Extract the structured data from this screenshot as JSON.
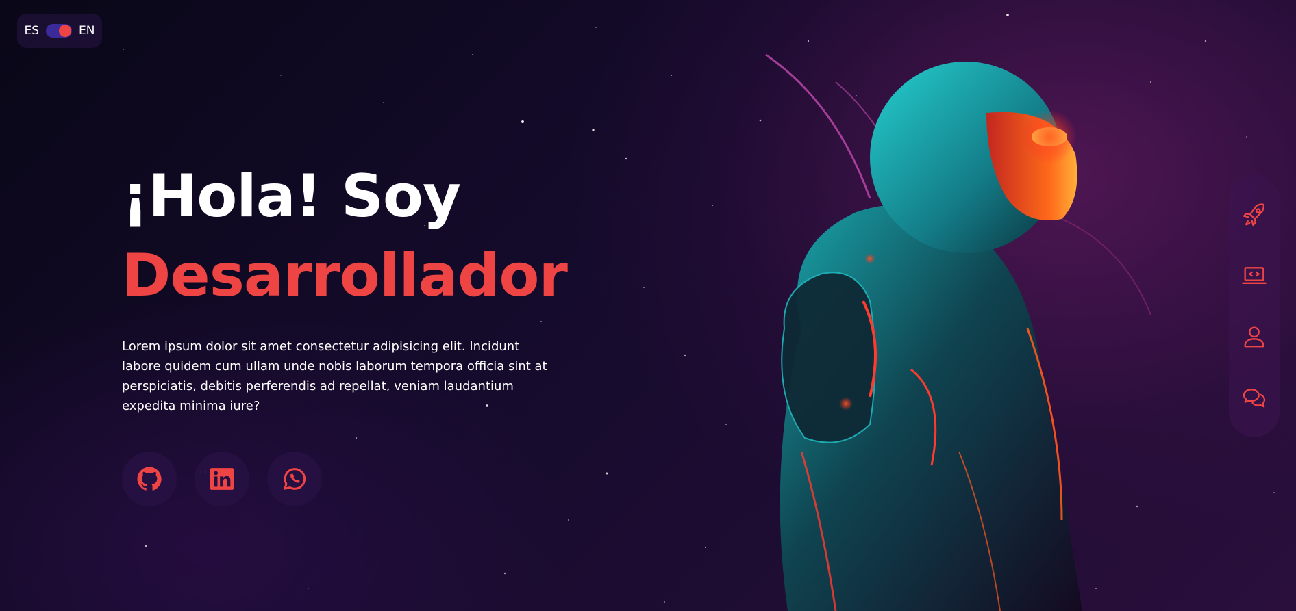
{
  "language_toggle": {
    "left_label": "ES",
    "right_label": "EN"
  },
  "hero": {
    "greeting": "¡Hola! Soy",
    "role": "Desarrollador",
    "description": "Lorem ipsum dolor sit amet consectetur adipisicing elit. Incidunt labore quidem cum ullam unde nobis laborum tempora officia sint at perspiciatis, debitis perferendis ad repellat, veniam laudantium expedita minima iure?"
  },
  "socials": [
    {
      "icon": "github-icon"
    },
    {
      "icon": "linkedin-icon"
    },
    {
      "icon": "whatsapp-icon"
    }
  ],
  "side_nav": [
    {
      "icon": "rocket-icon"
    },
    {
      "icon": "laptop-code-icon"
    },
    {
      "icon": "user-icon"
    },
    {
      "icon": "chat-icon"
    }
  ],
  "colors": {
    "accent": "#ef4444",
    "toggle_track": "#3a2a9a",
    "background": "#140a2a"
  }
}
